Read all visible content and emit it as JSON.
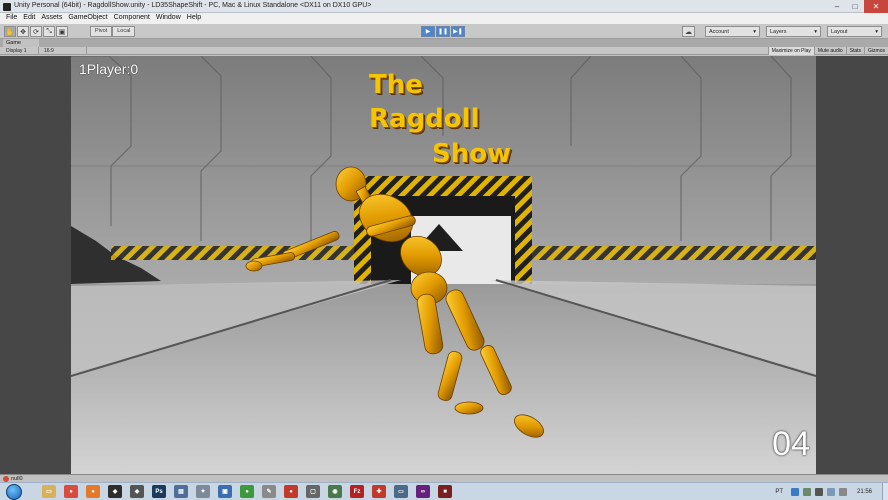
{
  "window": {
    "title": "Unity Personal (64bit) - RagdollShow.unity - LD35ShapeShift - PC, Mac & Linux Standalone <DX11 on DX10 GPU>",
    "controls": [
      "–",
      "□",
      "✕"
    ]
  },
  "menubar": {
    "items": [
      "File",
      "Edit",
      "Assets",
      "GameObject",
      "Component",
      "Window",
      "Help"
    ]
  },
  "toolbar": {
    "tools": [
      "✋",
      "✥",
      "⟳",
      "⤡",
      "▣"
    ],
    "pivot_label": "Pivot",
    "local_label": "Local",
    "play_icons": [
      "▶",
      "❚❚",
      "▶❚"
    ],
    "account_label": "Account",
    "layers_label": "Layers",
    "layout_label": "Layout",
    "dropdown_caret": "▾",
    "cloud_icon": "☁"
  },
  "game_panel": {
    "tab_label": "Game",
    "display_label": "Display 1",
    "aspect_label": "16:9",
    "options": [
      "Maximize on Play",
      "Mute audio",
      "Stats",
      "Gizmos"
    ]
  },
  "game": {
    "score_text": "1Player:0",
    "timer_text": "04",
    "logo_lines": [
      "The",
      "Ragdoll",
      "Show"
    ]
  },
  "statusbar": {
    "text": "null0"
  },
  "taskbar": {
    "apps": [
      {
        "name": "explorer",
        "glyph": "▭",
        "color": "#d7b25a"
      },
      {
        "name": "chrome",
        "glyph": "●",
        "color": "#d94b3c"
      },
      {
        "name": "firefox",
        "glyph": "●",
        "color": "#e4792a"
      },
      {
        "name": "unity",
        "glyph": "◆",
        "color": "#2d2d2d"
      },
      {
        "name": "unity-alt",
        "glyph": "◆",
        "color": "#555555"
      },
      {
        "name": "photoshop",
        "glyph": "Ps",
        "color": "#1c3a5e"
      },
      {
        "name": "app-doc",
        "glyph": "▤",
        "color": "#4d6f9a"
      },
      {
        "name": "app-people",
        "glyph": "✦",
        "color": "#7d8a9a"
      },
      {
        "name": "app-window",
        "glyph": "▣",
        "color": "#3c6fb0"
      },
      {
        "name": "app-green",
        "glyph": "●",
        "color": "#3c9a3c"
      },
      {
        "name": "app-tool",
        "glyph": "✎",
        "color": "#8a8a8a"
      },
      {
        "name": "app-red",
        "glyph": "●",
        "color": "#c0392b"
      },
      {
        "name": "app-box",
        "glyph": "▢",
        "color": "#666666"
      },
      {
        "name": "app-eye",
        "glyph": "◉",
        "color": "#4a7a4a"
      },
      {
        "name": "filezilla",
        "glyph": "Fz",
        "color": "#b22222"
      },
      {
        "name": "app-puzzle",
        "glyph": "✚",
        "color": "#c0392b"
      },
      {
        "name": "app-monitor",
        "glyph": "▭",
        "color": "#4a6a8a"
      },
      {
        "name": "visual-studio",
        "glyph": "∞",
        "color": "#68217a"
      },
      {
        "name": "app-dark",
        "glyph": "■",
        "color": "#7a1f1f"
      }
    ],
    "language": "PT",
    "clock": "21:56"
  }
}
